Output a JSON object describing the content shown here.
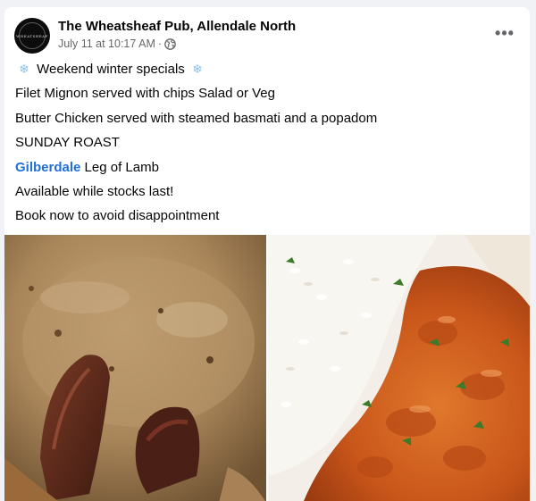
{
  "post": {
    "page_name": "The Wheatsheaf Pub, Allendale North",
    "timestamp": "July 11 at 10:17 AM",
    "separator": "·",
    "audience_icon": "globe-icon",
    "more_icon": "more-options-icon",
    "more_label": "•••",
    "avatar_text": "WHEATSHEAF",
    "snowflake_glyph": "❄",
    "lines": {
      "l1": "Weekend winter specials",
      "l2": "Filet Mignon served with chips Salad or Veg",
      "l3": "Butter Chicken served with steamed basmati and a popadom",
      "l4": "SUNDAY ROAST",
      "l5_link": "Gilberdale",
      "l5_rest": " Leg of Lamb",
      "l6": "Available while stocks last!",
      "l7": "Book now to avoid disappointment"
    }
  },
  "colors": {
    "link": "#216fdb",
    "meta": "#65676b",
    "snowflake": "#8ec3e8"
  }
}
